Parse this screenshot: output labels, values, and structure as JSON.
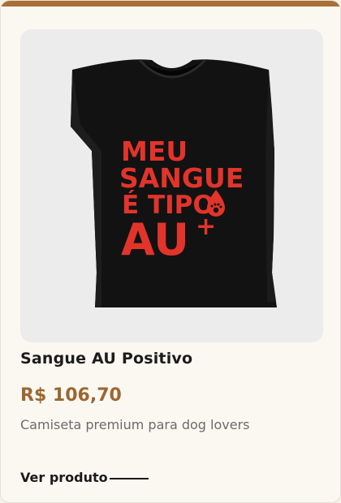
{
  "product": {
    "title": "Sangue AU Positivo",
    "price": "R$ 106,70",
    "description": "Camiseta premium para dog lovers",
    "cta_label": "Ver produto"
  },
  "shirt_print": {
    "line1": "MEU",
    "line2": "SANGUE",
    "line3": "É TIPO",
    "line4": "AU",
    "line4_suffix": "+"
  },
  "colors": {
    "accent_bar": "#a86f36",
    "price": "#9b6730",
    "print": "#e2342b",
    "shirt": "#111111"
  },
  "icons": {
    "print_icon": "blood-drop-paw-icon"
  }
}
